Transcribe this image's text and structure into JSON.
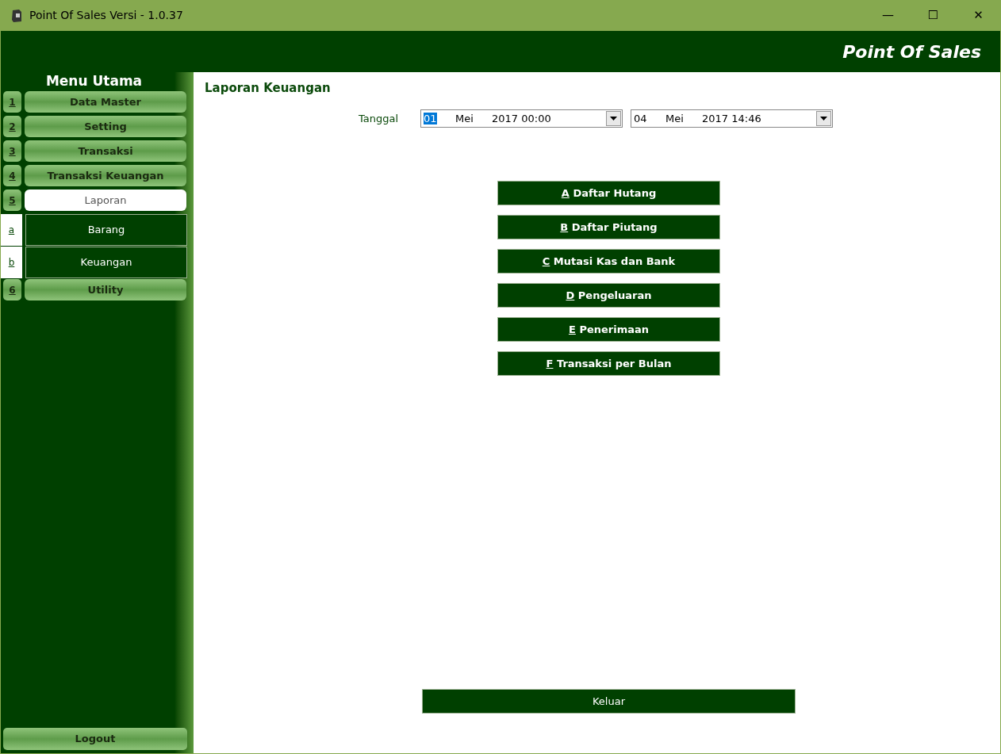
{
  "window": {
    "title": "Point Of Sales Versi - 1.0.37",
    "controls": [
      "—",
      "☐",
      "✕"
    ]
  },
  "header": {
    "title": "Point Of Sales"
  },
  "sidebar": {
    "title": "Menu Utama",
    "items": [
      {
        "kind": "main",
        "key": "1",
        "label": "Data Master",
        "selected": false
      },
      {
        "kind": "main",
        "key": "2",
        "label": "Setting",
        "selected": false
      },
      {
        "kind": "main",
        "key": "3",
        "label": "Transaksi",
        "selected": false
      },
      {
        "kind": "main",
        "key": "4",
        "label": "Transaksi Keuangan",
        "selected": false
      },
      {
        "kind": "main",
        "key": "5",
        "label": "Laporan",
        "selected": true
      },
      {
        "kind": "sub",
        "key": "a",
        "label": "Barang",
        "selected": false
      },
      {
        "kind": "sub",
        "key": "b",
        "label": "Keuangan",
        "selected": false
      },
      {
        "kind": "main",
        "key": "6",
        "label": "Utility",
        "selected": false
      }
    ],
    "logout": "Logout"
  },
  "content": {
    "title": "Laporan Keuangan",
    "date_label": "Tanggal",
    "dates": [
      {
        "day": "01",
        "month": "Mei",
        "rest": "2017 00:00",
        "focused": true
      },
      {
        "day": "04",
        "month": "Mei",
        "rest": "2017 14:46",
        "focused": false
      }
    ],
    "reports": [
      {
        "key": "A",
        "label": "Daftar Hutang"
      },
      {
        "key": "B",
        "label": "Daftar Piutang"
      },
      {
        "key": "C",
        "label": "Mutasi Kas dan Bank"
      },
      {
        "key": "D",
        "label": "Pengeluaran"
      },
      {
        "key": "E",
        "label": "Penerimaan"
      },
      {
        "key": "F",
        "label": "Transaksi per Bulan"
      }
    ],
    "exit": "Keluar"
  }
}
